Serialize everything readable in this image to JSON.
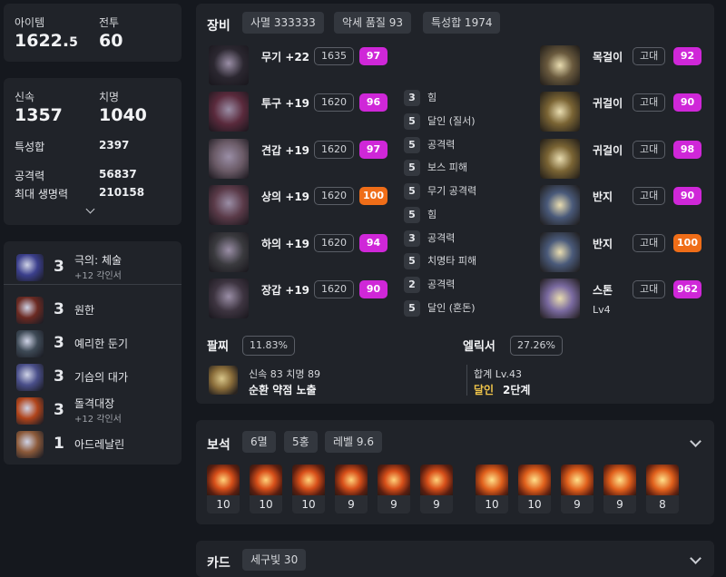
{
  "summary": {
    "item_label": "아이템",
    "item_value_main": "1622.",
    "item_value_frac": "5",
    "combat_label": "전투",
    "combat_value": "60"
  },
  "stats": {
    "swift_label": "신속",
    "swift_value": "1357",
    "crit_label": "치명",
    "crit_value": "1040",
    "special_label": "특성합",
    "special_value": "2397",
    "atk_label": "공격력",
    "atk_value": "56837",
    "hp_label": "최대 생명력",
    "hp_value": "210158"
  },
  "engravings": [
    {
      "level": "3",
      "name": "극의: 체술",
      "sub": "+12 각인서",
      "icon_color": "#3b3f8c"
    },
    {
      "level": "3",
      "name": "원한",
      "sub": "",
      "icon_color": "#6b2a22"
    },
    {
      "level": "3",
      "name": "예리한 둔기",
      "sub": "",
      "icon_color": "#3e4a56"
    },
    {
      "level": "3",
      "name": "기습의 대가",
      "sub": "",
      "icon_color": "#4a4f8a"
    },
    {
      "level": "3",
      "name": "돌격대장",
      "sub": "+12 각인서",
      "icon_color": "#b0441b"
    },
    {
      "level": "1",
      "name": "아드레날린",
      "sub": "",
      "icon_color": "#8c5a3a"
    }
  ],
  "equipment": {
    "title": "장비",
    "chips": [
      "사멸 333333",
      "악세 품질 93",
      "특성합 1974"
    ],
    "gear": [
      {
        "name": "무기 +22",
        "level": "1635",
        "quality": "97",
        "qcolor": "m",
        "icon_color": "#2b2730",
        "effects": []
      },
      {
        "name": "투구 +19",
        "level": "1620",
        "quality": "96",
        "qcolor": "m",
        "icon_color": "#5a2a3c",
        "effects": [
          {
            "lv": "3",
            "text": "힘"
          },
          {
            "lv": "5",
            "text": "달인 (질서)"
          }
        ]
      },
      {
        "name": "견갑 +19",
        "level": "1620",
        "quality": "97",
        "qcolor": "m",
        "icon_color": "#6a5a66",
        "effects": [
          {
            "lv": "5",
            "text": "공격력"
          },
          {
            "lv": "5",
            "text": "보스 피해"
          }
        ]
      },
      {
        "name": "상의 +19",
        "level": "1620",
        "quality": "100",
        "qcolor": "o",
        "icon_color": "#5a3a48",
        "effects": [
          {
            "lv": "5",
            "text": "무기 공격력"
          },
          {
            "lv": "5",
            "text": "힘"
          }
        ]
      },
      {
        "name": "하의 +19",
        "level": "1620",
        "quality": "94",
        "qcolor": "m",
        "icon_color": "#3a3a3e",
        "effects": [
          {
            "lv": "3",
            "text": "공격력"
          },
          {
            "lv": "5",
            "text": "치명타 피해"
          }
        ]
      },
      {
        "name": "장갑 +19",
        "level": "1620",
        "quality": "90",
        "qcolor": "m",
        "icon_color": "#3d3440",
        "effects": [
          {
            "lv": "2",
            "text": "공격력"
          },
          {
            "lv": "5",
            "text": "달인 (혼돈)"
          }
        ]
      }
    ],
    "accessories": [
      {
        "name": "목걸이",
        "grade": "고대",
        "quality": "92",
        "qcolor": "m",
        "icon_color": "#6a5a3e"
      },
      {
        "name": "귀걸이",
        "grade": "고대",
        "quality": "90",
        "qcolor": "m",
        "icon_color": "#7a6434"
      },
      {
        "name": "귀걸이",
        "grade": "고대",
        "quality": "98",
        "qcolor": "m",
        "icon_color": "#7a6434"
      },
      {
        "name": "반지",
        "grade": "고대",
        "quality": "90",
        "qcolor": "m",
        "icon_color": "#4a5a7a"
      },
      {
        "name": "반지",
        "grade": "고대",
        "quality": "100",
        "qcolor": "o",
        "icon_color": "#4a5a7a"
      },
      {
        "name": "스톤",
        "grade": "고대",
        "quality": "962",
        "qcolor": "m",
        "icon_color": "#7a6aa0",
        "sub": "Lv4"
      }
    ],
    "bracelet_label": "팔찌",
    "bracelet_value": "11.83%",
    "bracelet_stats": "신속 83  치명 89",
    "bracelet_effects": "순환  약점 노출",
    "elixir_label": "엘릭서",
    "elixir_value": "27.26%",
    "elixir_total": "합계 Lv.43",
    "elixir_set_name": "달인",
    "elixir_set_stage": "2단계"
  },
  "gems": {
    "title": "보석",
    "chips": [
      "6멸",
      "5홍",
      "레벨 9.6"
    ],
    "group1": [
      "10",
      "10",
      "10",
      "9",
      "9",
      "9"
    ],
    "group2": [
      "10",
      "10",
      "9",
      "9",
      "8"
    ]
  },
  "cards": {
    "title": "카드",
    "chip": "세구빛 30"
  },
  "colors": {
    "quality_magenta": "#cf27d8",
    "quality_orange": "#ef6d18",
    "elixir_accent": "#f0c54a"
  }
}
